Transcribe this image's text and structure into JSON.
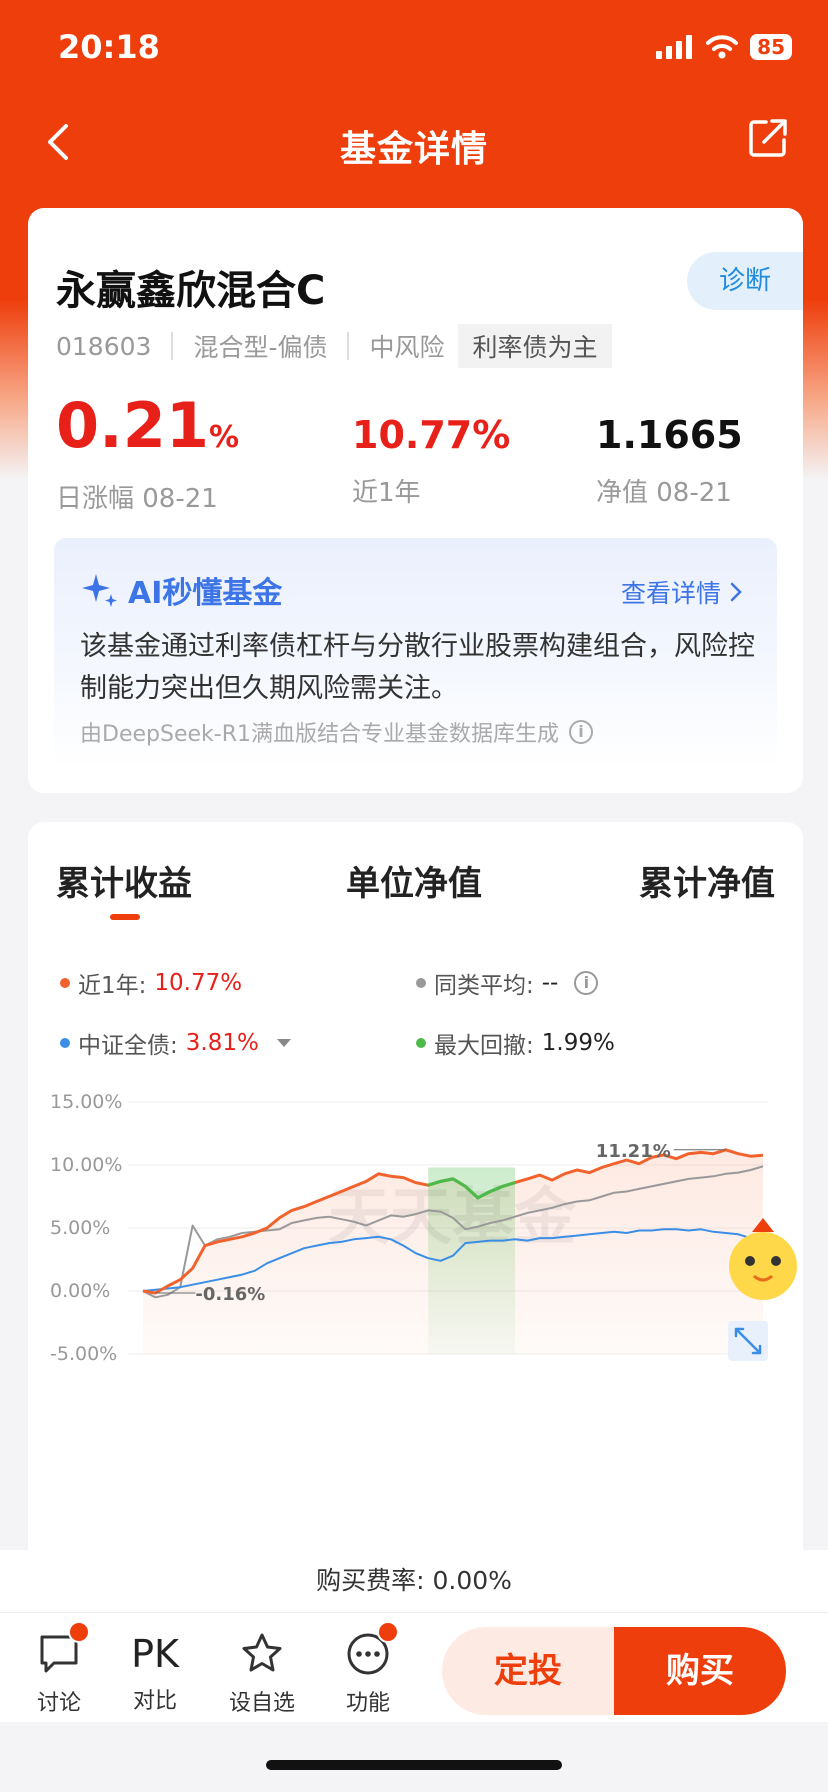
{
  "status": {
    "time": "20:18",
    "battery": "85"
  },
  "nav": {
    "title": "基金详情"
  },
  "fund": {
    "name": "永赢鑫欣混合C",
    "diagnose_label": "诊断",
    "code": "018603",
    "type": "混合型-偏债",
    "risk": "中风险",
    "tag": "利率债为主",
    "daily_change_value": "0.21",
    "daily_change_unit": "%",
    "daily_change_label": "日涨幅 08-21",
    "year_return": "10.77%",
    "year_return_label": "近1年",
    "nav_value": "1.1665",
    "nav_label": "净值 08-21"
  },
  "ai": {
    "title": "AI秒懂基金",
    "more_label": "查看详情",
    "summary": "该基金通过利率债杠杆与分散行业股票构建组合，风险控制能力突出但久期风险需关注。",
    "note": "由DeepSeek-R1满血版结合专业基金数据库生成"
  },
  "chart_tabs": [
    "累计收益",
    "单位净值",
    "累计净值"
  ],
  "legend": {
    "fund_label": "近1年: ",
    "fund_value": "10.77%",
    "peer_label": "同类平均: ",
    "peer_value": "--",
    "bench_label": "中证全债: ",
    "bench_value": "3.81%",
    "drawdown_label": "最大回撤: ",
    "drawdown_value": "1.99%"
  },
  "watermark": "天天基金",
  "colors": {
    "fund": "#f2622c",
    "peer": "#999999",
    "bench": "#3a8ee6",
    "drawdown": "#4cbb4c",
    "brand": "#ee3e0c"
  },
  "chart_data": {
    "type": "line",
    "x": [
      0,
      1,
      2,
      3,
      4,
      5,
      6,
      7,
      8,
      9,
      10,
      11,
      12,
      13,
      14,
      15,
      16,
      17,
      18,
      19,
      20,
      21,
      22,
      23,
      24,
      25,
      26,
      27,
      28,
      29,
      30,
      31,
      32,
      33,
      34,
      35,
      36,
      37,
      38,
      39,
      40,
      41,
      42,
      43,
      44,
      45,
      46,
      47,
      48,
      49,
      50
    ],
    "ylim": [
      -5,
      15
    ],
    "yticks": [
      "15.00%",
      "10.00%",
      "5.00%",
      "0.00%",
      "-5.00%"
    ],
    "series": [
      {
        "name": "近1年",
        "values": [
          0.0,
          -0.16,
          0.4,
          0.9,
          1.8,
          3.6,
          3.9,
          4.1,
          4.3,
          4.6,
          5.0,
          5.8,
          6.4,
          6.7,
          7.1,
          7.5,
          7.9,
          8.3,
          8.7,
          9.3,
          9.1,
          9.0,
          8.6,
          8.4,
          8.7,
          8.9,
          8.3,
          7.4,
          7.9,
          8.3,
          8.6,
          8.9,
          9.2,
          8.8,
          9.3,
          9.6,
          9.4,
          9.8,
          10.1,
          10.4,
          10.1,
          10.6,
          10.8,
          10.5,
          10.9,
          11.0,
          10.9,
          11.21,
          10.9,
          10.7,
          10.77
        ]
      },
      {
        "name": "同类平均",
        "values": [
          0.0,
          -0.5,
          -0.3,
          0.3,
          5.2,
          3.6,
          4.1,
          4.3,
          4.6,
          4.7,
          4.8,
          4.9,
          5.4,
          5.6,
          5.8,
          5.9,
          5.7,
          5.5,
          5.2,
          5.6,
          6.0,
          5.9,
          6.1,
          6.4,
          6.3,
          5.8,
          4.9,
          5.1,
          5.4,
          5.6,
          5.9,
          6.2,
          6.4,
          6.6,
          6.9,
          7.1,
          7.2,
          7.5,
          7.8,
          7.9,
          8.1,
          8.3,
          8.5,
          8.7,
          8.9,
          9.0,
          9.1,
          9.3,
          9.4,
          9.6,
          9.9
        ]
      },
      {
        "name": "中证全债",
        "values": [
          0.0,
          0.1,
          0.2,
          0.3,
          0.5,
          0.7,
          0.9,
          1.1,
          1.3,
          1.6,
          2.2,
          2.6,
          3.0,
          3.4,
          3.6,
          3.8,
          3.9,
          4.1,
          4.2,
          4.3,
          4.1,
          3.6,
          3.0,
          2.6,
          2.4,
          2.8,
          3.8,
          3.9,
          4.0,
          4.0,
          4.1,
          4.0,
          4.2,
          4.2,
          4.3,
          4.4,
          4.5,
          4.6,
          4.7,
          4.6,
          4.8,
          4.8,
          4.9,
          4.9,
          4.8,
          4.9,
          4.7,
          4.6,
          4.5,
          4.2,
          3.81
        ]
      }
    ],
    "drawdown_range": [
      23,
      30
    ],
    "annotations": {
      "max_label": "11.21%",
      "min_label": "-0.16%"
    }
  },
  "fee": {
    "label": "购买费率: ",
    "value": "0.00%"
  },
  "bottom": {
    "discuss": "讨论",
    "pk_icon": "PK",
    "compare": "对比",
    "watch": "设自选",
    "func": "功能",
    "invest": "定投",
    "buy": "购买"
  }
}
